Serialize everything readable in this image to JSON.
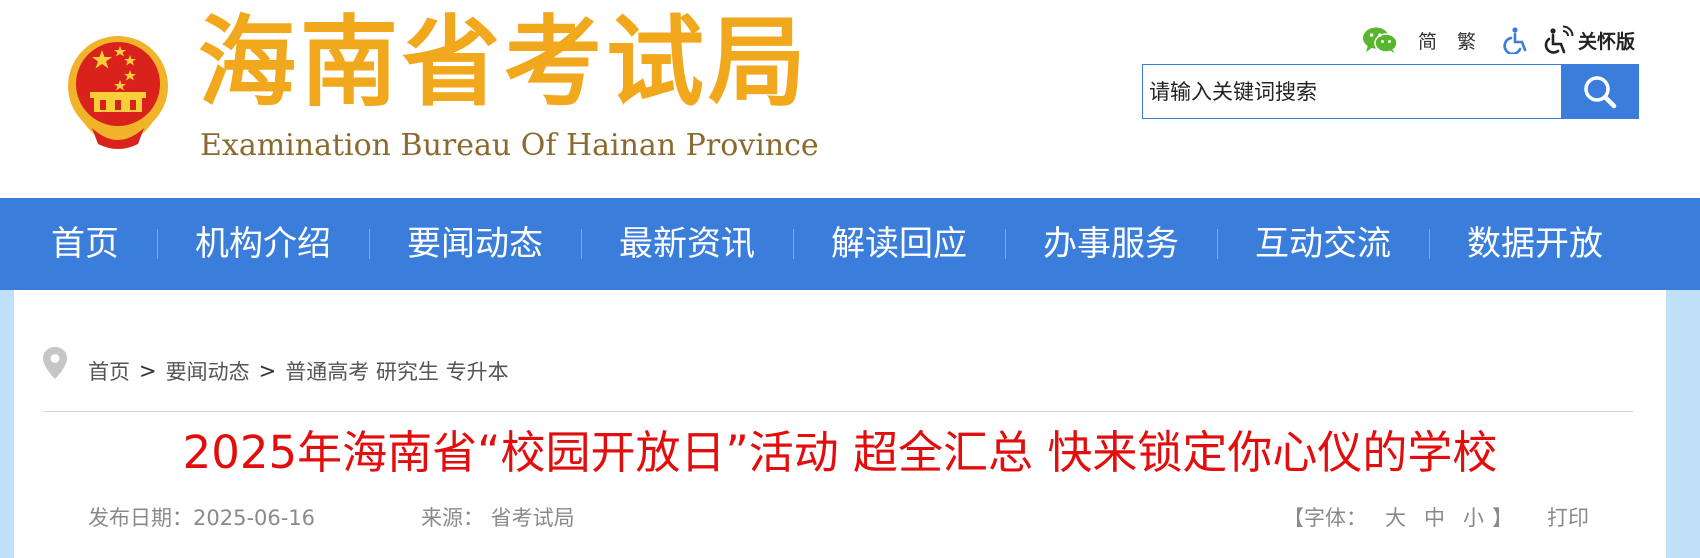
{
  "header": {
    "logo_cn": "海南省考试局",
    "logo_en": "Examination Bureau Of Hainan Province",
    "tools": {
      "simplified": "简",
      "traditional": "繁",
      "care_mode": "关怀版"
    },
    "search": {
      "placeholder": "请输入关键词搜索"
    }
  },
  "nav": {
    "items": [
      "首页",
      "机构介绍",
      "要闻动态",
      "最新资讯",
      "解读回应",
      "办事服务",
      "互动交流",
      "数据开放"
    ]
  },
  "breadcrumb": {
    "items": [
      "首页",
      "要闻动态",
      "普通高考 研究生 专升本"
    ],
    "separator": ">"
  },
  "article": {
    "title": "2025年海南省“校园开放日”活动 超全汇总 快来锁定你心仪的学校",
    "publish_date": "发布日期：2025-06-16",
    "source": "来源： 省考试局",
    "font_label_open": "【字体：",
    "font_large": "大",
    "font_medium": "中",
    "font_small": "小",
    "font_label_close": "】",
    "print": "打印"
  },
  "icons": {
    "emblem": "national-emblem-icon",
    "wechat": "wechat-icon",
    "accessibility": "accessibility-icon",
    "care": "wheelchair-audio-icon",
    "search": "search-icon",
    "location": "location-pin-icon"
  },
  "colors": {
    "brand_blue": "#3a7ddb",
    "logo_gold": "#f2a81d",
    "title_red": "#e20e0e",
    "wechat_green": "#57b52e"
  }
}
